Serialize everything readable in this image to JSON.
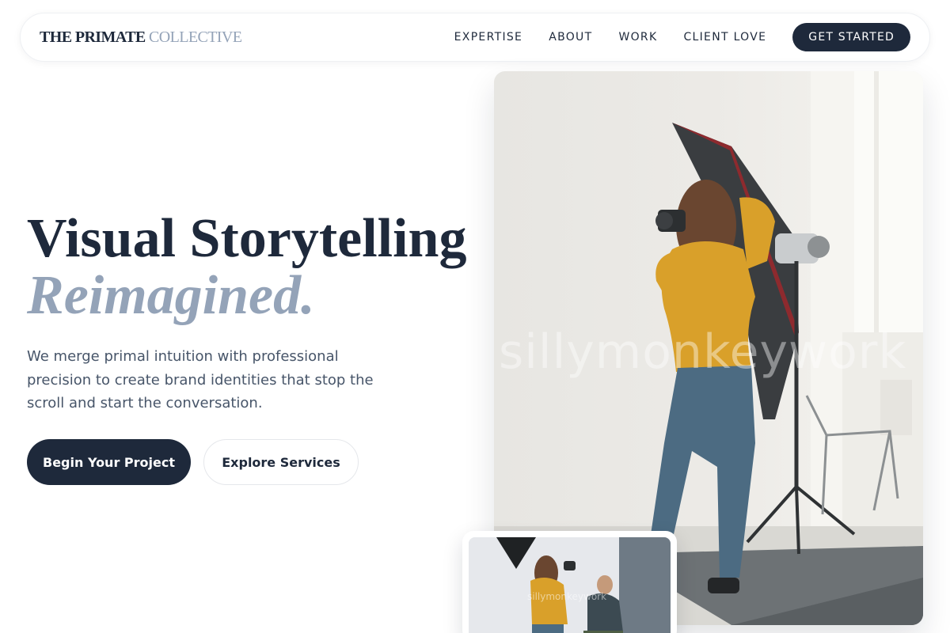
{
  "brand": {
    "name_primary": "THE PRIMATE",
    "name_secondary": "COLLECTIVE"
  },
  "nav": {
    "links": [
      "EXPERTISE",
      "ABOUT",
      "WORK",
      "CLIENT LOVE"
    ],
    "cta": "GET STARTED"
  },
  "hero": {
    "title_line1": "Visual Storytelling",
    "title_line2": "Reimagined.",
    "subtitle": "We merge primal intuition with professional precision to create brand identities that stop the scroll and start the conversation.",
    "primary_button": "Begin Your Project",
    "secondary_button": "Explore Services"
  },
  "images": {
    "main_alt": "Photographer in a studio with softbox lighting",
    "watermark": "sillymonkeywork",
    "thumb_alt": "Photographer shooting a seated model"
  },
  "colors": {
    "primary": "#1e293b",
    "muted": "#94a3b8",
    "body_text": "#475569",
    "accent": "#d9a02a"
  }
}
